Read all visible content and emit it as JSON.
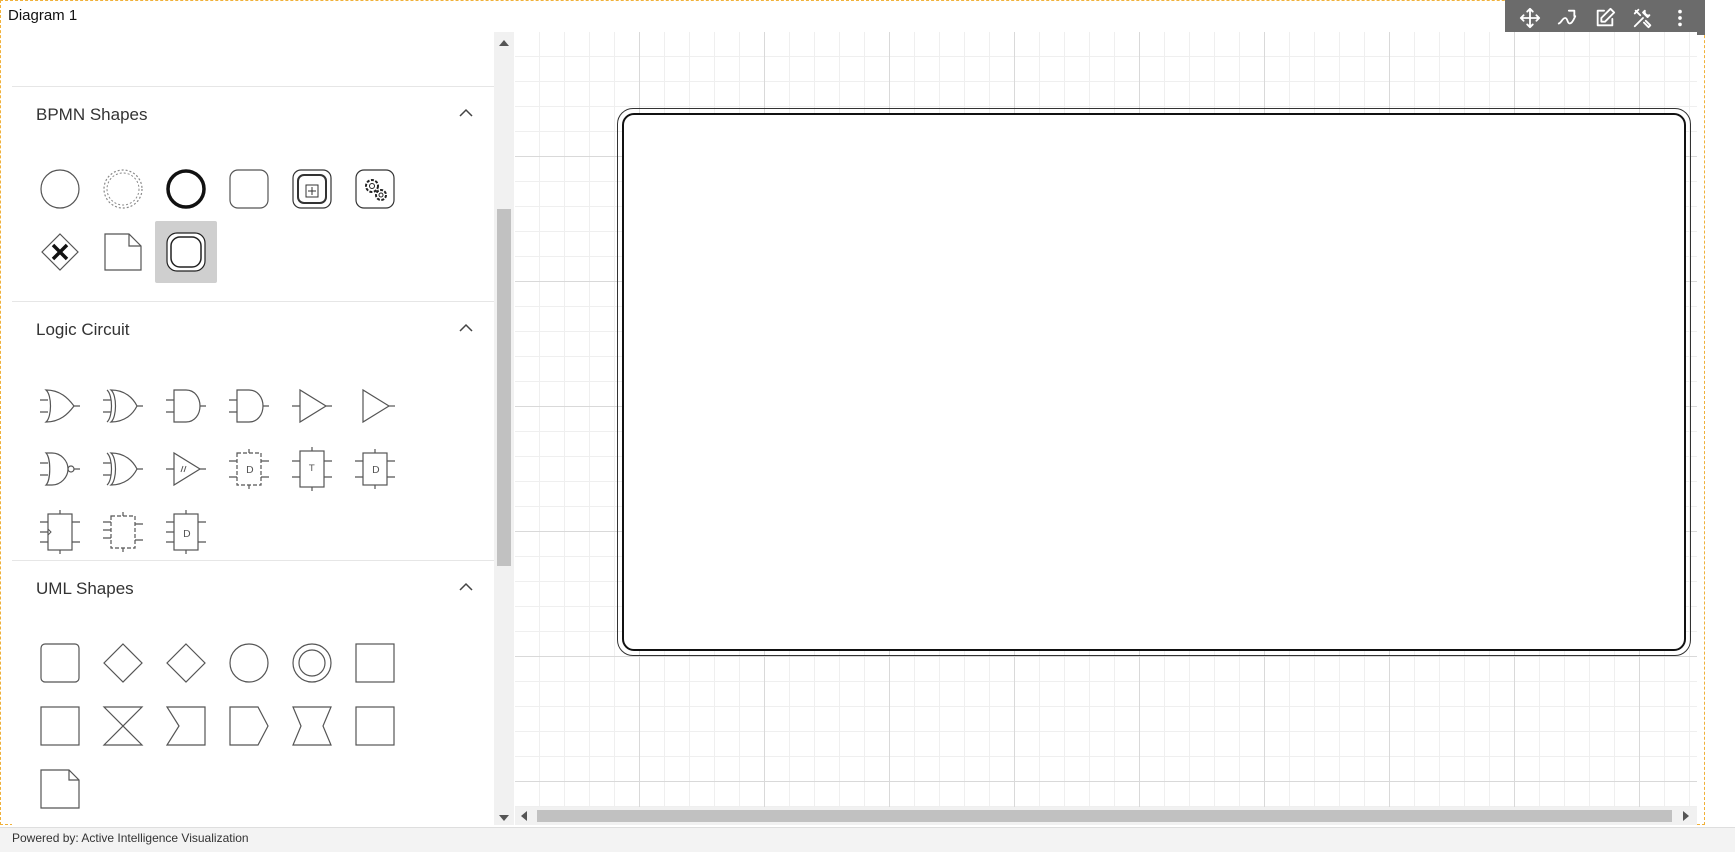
{
  "diagram": {
    "title": "Diagram 1"
  },
  "toolbar": {
    "buttons": [
      {
        "name": "move-icon"
      },
      {
        "name": "connector-icon"
      },
      {
        "name": "edit-icon"
      },
      {
        "name": "tools-icon"
      },
      {
        "name": "more-icon"
      }
    ]
  },
  "palette": {
    "sections": [
      {
        "title": "BPMN Shapes",
        "expanded": true
      },
      {
        "title": "Logic Circuit",
        "expanded": true
      },
      {
        "title": "UML Shapes",
        "expanded": true
      }
    ]
  },
  "footer": {
    "text": "Powered by: Active Intelligence Visualization"
  },
  "colors": {
    "accent_border": "#f0b13a",
    "toolbar_bg": "#6b6b6b",
    "selected_bg": "#cfcfcf"
  }
}
